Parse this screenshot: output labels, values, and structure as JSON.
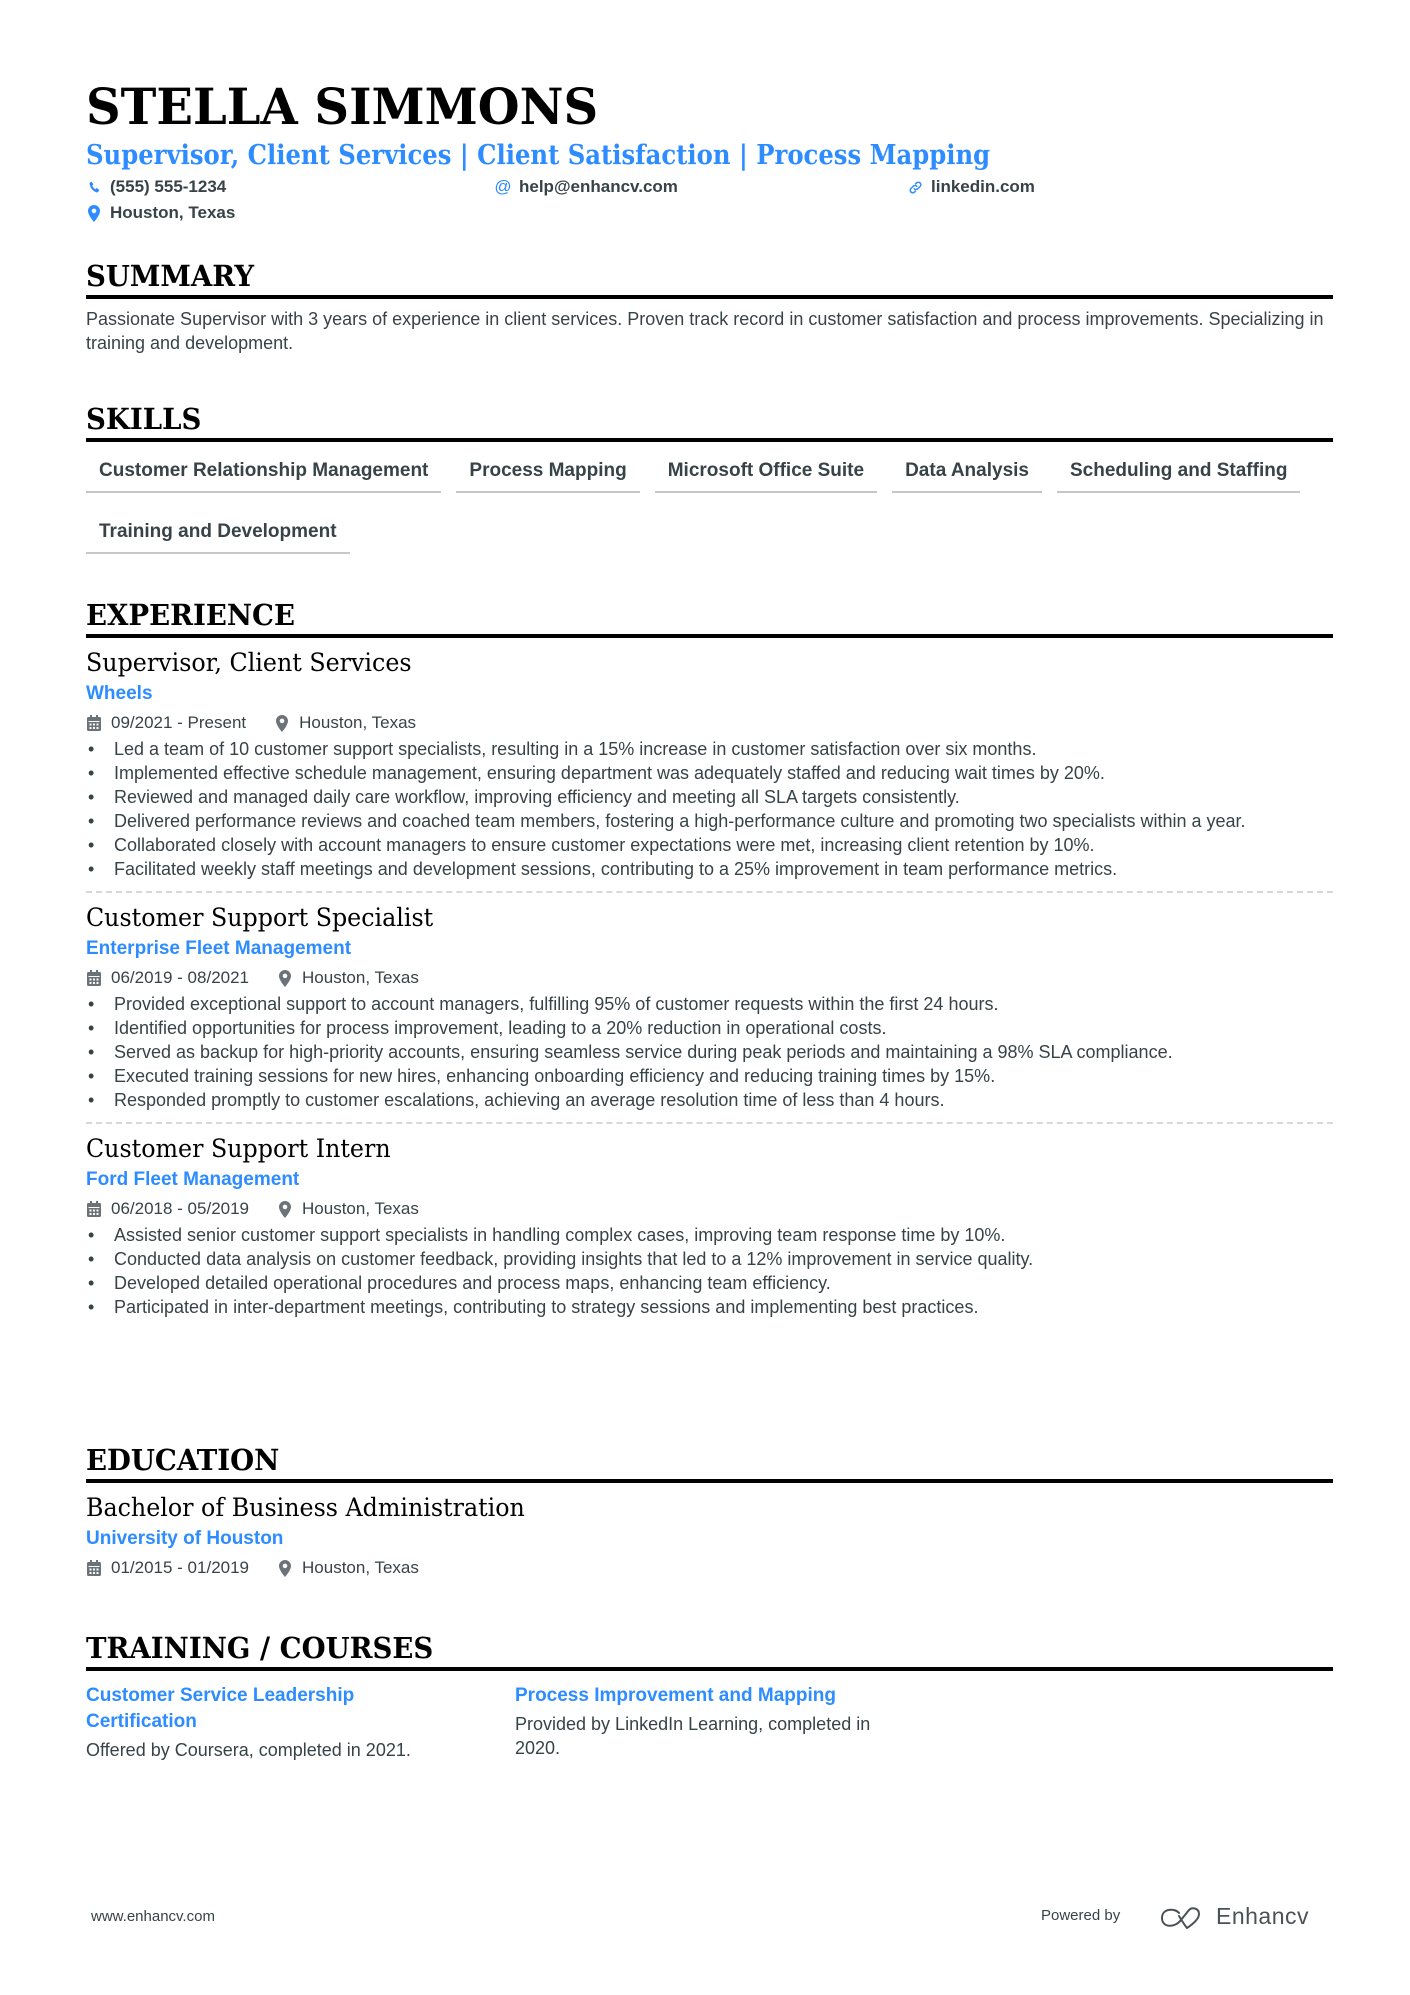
{
  "header": {
    "name": "STELLA SIMMONS",
    "headline": "Supervisor, Client Services | Client Satisfaction | Process Mapping",
    "contacts": {
      "phone": {
        "icon": "phone-icon",
        "text": "(555) 555-1234"
      },
      "email": {
        "icon": "at-icon",
        "text": "help@enhancv.com"
      },
      "link": {
        "icon": "link-icon",
        "text": "linkedin.com"
      },
      "location": {
        "icon": "location-pin-icon",
        "text": "Houston, Texas"
      }
    }
  },
  "summary": {
    "title": "SUMMARY",
    "text": "Passionate Supervisor with 3 years of experience in client services. Proven track record in customer satisfaction and process improvements. Specializing in training and development."
  },
  "skills": {
    "title": "SKILLS",
    "items": [
      "Customer Relationship Management",
      "Process Mapping",
      "Microsoft Office Suite",
      "Data Analysis",
      "Scheduling and Staffing",
      "Training and Development"
    ]
  },
  "experience": {
    "title": "EXPERIENCE",
    "jobs": [
      {
        "title": "Supervisor, Client Services",
        "company": "Wheels",
        "dates": "09/2021 - Present",
        "location": "Houston, Texas",
        "bullets": [
          "Led a team of 10 customer support specialists, resulting in a 15% increase in customer satisfaction over six months.",
          "Implemented effective schedule management, ensuring department was adequately staffed and reducing wait times by 20%.",
          "Reviewed and managed daily care workflow, improving efficiency and meeting all SLA targets consistently.",
          "Delivered performance reviews and coached team members, fostering a high-performance culture and promoting two specialists within a year.",
          "Collaborated closely with account managers to ensure customer expectations were met, increasing client retention by 10%.",
          "Facilitated weekly staff meetings and development sessions, contributing to a 25% improvement in team performance metrics."
        ]
      },
      {
        "title": "Customer Support Specialist",
        "company": "Enterprise Fleet Management",
        "dates": "06/2019 - 08/2021",
        "location": "Houston, Texas",
        "bullets": [
          "Provided exceptional support to account managers, fulfilling 95% of customer requests within the first 24 hours.",
          "Identified opportunities for process improvement, leading to a 20% reduction in operational costs.",
          "Served as backup for high-priority accounts, ensuring seamless service during peak periods and maintaining a 98% SLA compliance.",
          "Executed training sessions for new hires, enhancing onboarding efficiency and reducing training times by 15%.",
          "Responded promptly to customer escalations, achieving an average resolution time of less than 4 hours."
        ]
      },
      {
        "title": "Customer Support Intern",
        "company": "Ford Fleet Management",
        "dates": "06/2018 - 05/2019",
        "location": "Houston, Texas",
        "bullets": [
          "Assisted senior customer support specialists in handling complex cases, improving team response time by 10%.",
          "Conducted data analysis on customer feedback, providing insights that led to a 12% improvement in service quality.",
          "Developed detailed operational procedures and process maps, enhancing team efficiency.",
          "Participated in inter-department meetings, contributing to strategy sessions and implementing best practices."
        ]
      }
    ]
  },
  "education": {
    "title": "EDUCATION",
    "degree": "Bachelor of Business Administration",
    "school": "University of Houston",
    "dates": "01/2015 - 01/2019",
    "location": "Houston, Texas"
  },
  "training": {
    "title": "TRAINING / COURSES",
    "items": [
      {
        "title": "Customer Service Leadership Certification",
        "description": "Offered by Coursera, completed in 2021."
      },
      {
        "title": "Process Improvement and Mapping",
        "description": "Provided by LinkedIn Learning, completed in 2020."
      }
    ]
  },
  "footer": {
    "url": "www.enhancv.com",
    "powered_by": "Powered by",
    "brand": "Enhancv"
  },
  "colors": {
    "accent": "#2D8CFF",
    "text": "#384347",
    "heading": "#000000"
  }
}
